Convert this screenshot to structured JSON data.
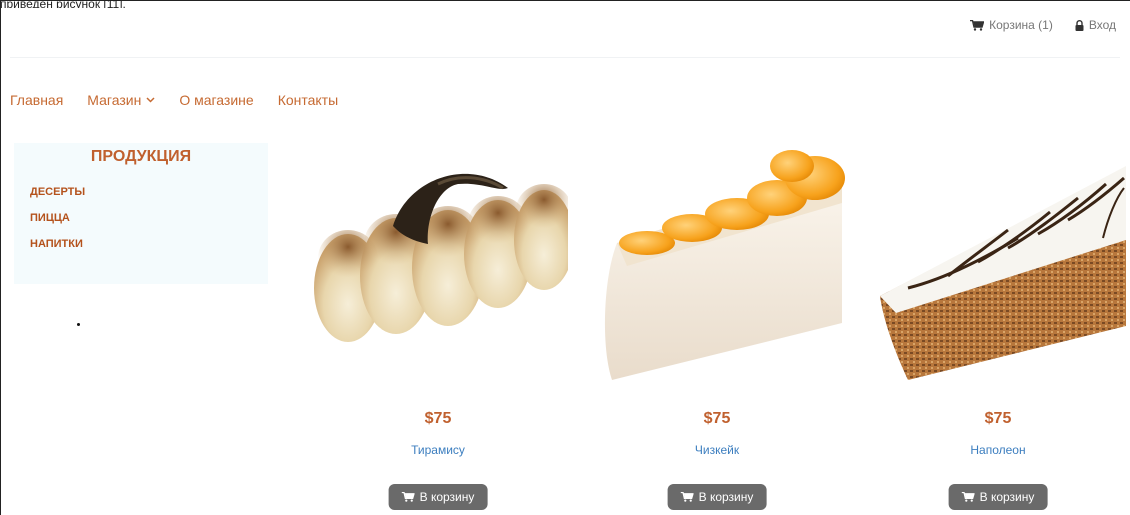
{
  "top_fragment": "приведен рисунок [11].",
  "header": {
    "cart_label": "Корзина (1)",
    "login_label": "Вход"
  },
  "nav": {
    "items": [
      {
        "label": "Главная"
      },
      {
        "label": "Магазин",
        "has_dropdown": true
      },
      {
        "label": "О магазине"
      },
      {
        "label": "Контакты"
      }
    ]
  },
  "sidebar": {
    "title": "ПРОДУКЦИЯ",
    "items": [
      "ДЕСЕРТЫ",
      "ПИЦЦА",
      "НАПИТКИ"
    ]
  },
  "products": [
    {
      "price": "$75",
      "name": "Тирамису",
      "button": "В корзину",
      "image": "tiramisu-image"
    },
    {
      "price": "$75",
      "name": "Чизкейк",
      "button": "В корзину",
      "image": "cheesecake-image"
    },
    {
      "price": "$75",
      "name": "Наполеон",
      "button": "В корзину",
      "image": "napoleon-image"
    }
  ],
  "colors": {
    "accent": "#c0602e",
    "link": "#3c7ebf",
    "button": "#6a6a6a",
    "sidebar_bg": "#f4fbfd"
  }
}
